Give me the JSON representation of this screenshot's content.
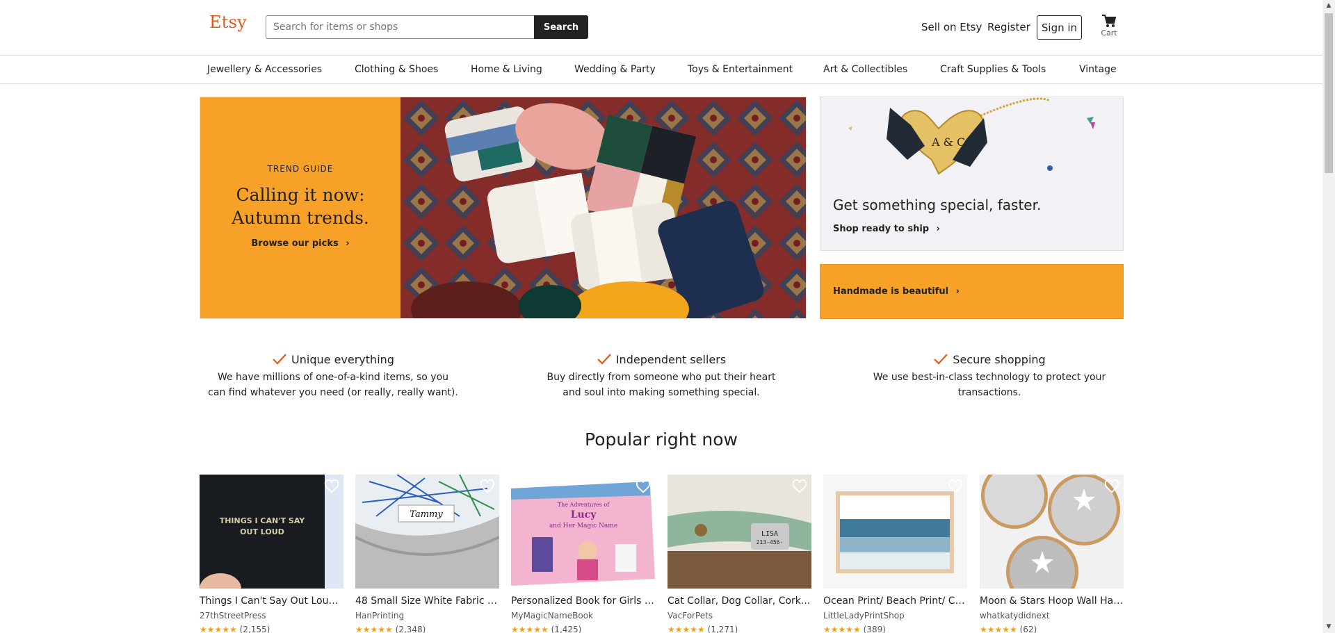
{
  "header": {
    "logo": "Etsy",
    "search_placeholder": "Search for items or shops",
    "search_button": "Search",
    "sell_link": "Sell on Etsy",
    "register_link": "Register",
    "signin_button": "Sign in",
    "cart_label": "Cart"
  },
  "categories": [
    "Jewellery & Accessories",
    "Clothing & Shoes",
    "Home & Living",
    "Wedding & Party",
    "Toys & Entertainment",
    "Art & Collectibles",
    "Craft Supplies & Tools",
    "Vintage"
  ],
  "hero": {
    "eyebrow": "TREND GUIDE",
    "title_line1": "Calling it now:",
    "title_line2": "Autumn trends.",
    "cta": "Browse our picks",
    "chevron": "›"
  },
  "special": {
    "title": "Get something special, faster.",
    "link": "Shop ready to ship",
    "chevron": "›",
    "pendant_text": "A & C"
  },
  "handmade": {
    "label": "Handmade is beautiful",
    "chevron": "›"
  },
  "value_props": [
    {
      "title": "Unique everything",
      "line1": "We have millions of one-of-a-kind items, so you",
      "line2": "can find whatever you need (or really, really want)."
    },
    {
      "title": "Independent sellers",
      "line1": "Buy directly from someone who put their heart",
      "line2": "and soul into making something special."
    },
    {
      "title": "Secure shopping",
      "line1": "We use best-in-class technology to protect your",
      "line2": "transactions."
    }
  ],
  "section_title": "Popular right now",
  "products": [
    {
      "title": "Things I Can't Say Out Loud...",
      "shop": "27thStreetPress",
      "stars": "★★★★★",
      "reviews": "(2,155)",
      "image_text_1": "THINGS I CAN'T SAY",
      "image_text_2": "OUT LOUD"
    },
    {
      "title": "48 Small Size White Fabric L...",
      "shop": "HanPrinting",
      "stars": "★★★★★",
      "reviews": "(2,348)",
      "image_text_1": "Tammy"
    },
    {
      "title": "Personalized Book for Girls -...",
      "shop": "MyMagicNameBook",
      "stars": "★★★★★",
      "reviews": "(1,425)",
      "image_text_1": "The Adventures of",
      "image_text_2": "Lucy",
      "image_text_3": "and Her Magic Name"
    },
    {
      "title": "Cat Collar, Dog Collar, Cork...",
      "shop": "VacForPets",
      "stars": "★★★★★",
      "reviews": "(1,271)",
      "image_text_1": "LISA",
      "image_text_2": "213-456-"
    },
    {
      "title": "Ocean Print/ Beach Print/ Co...",
      "shop": "LittleLadyPrintShop",
      "stars": "★★★★★",
      "reviews": "(389)"
    },
    {
      "title": "Moon & Stars Hoop Wall Han...",
      "shop": "whatkatydidnext",
      "stars": "★★★★★",
      "reviews": "(62)"
    }
  ],
  "icons": {
    "cart": "cart-icon",
    "check": "check-icon",
    "heart": "heart-icon",
    "chevron": "chevron-right-icon"
  },
  "colors": {
    "brand": "#e35a16",
    "accent": "#f8a129",
    "check": "#e35a16",
    "stars": "#f1a10d"
  }
}
